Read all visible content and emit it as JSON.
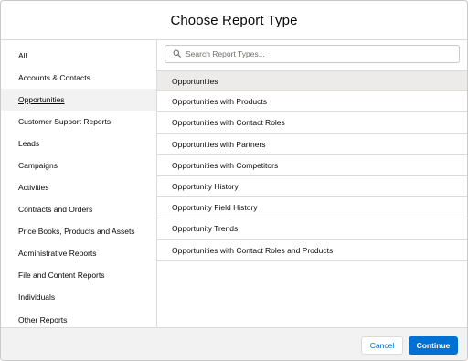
{
  "modal": {
    "title": "Choose Report Type"
  },
  "sidebar": {
    "items": [
      {
        "label": "All"
      },
      {
        "label": "Accounts & Contacts"
      },
      {
        "label": "Opportunities",
        "selected": true
      },
      {
        "label": "Customer Support Reports"
      },
      {
        "label": "Leads"
      },
      {
        "label": "Campaigns"
      },
      {
        "label": "Activities"
      },
      {
        "label": "Contracts and Orders"
      },
      {
        "label": "Price Books, Products and Assets"
      },
      {
        "label": "Administrative Reports"
      },
      {
        "label": "File and Content Reports"
      },
      {
        "label": "Individuals"
      },
      {
        "label": "Other Reports"
      }
    ]
  },
  "search": {
    "placeholder": "Search Report Types...",
    "icon": "search-icon"
  },
  "report_types": [
    {
      "label": "Opportunities",
      "selected": true
    },
    {
      "label": "Opportunities with Products"
    },
    {
      "label": "Opportunities with Contact Roles"
    },
    {
      "label": "Opportunities with Partners"
    },
    {
      "label": "Opportunities with Competitors"
    },
    {
      "label": "Opportunity History"
    },
    {
      "label": "Opportunity Field History"
    },
    {
      "label": "Opportunity Trends"
    },
    {
      "label": "Opportunities with Contact Roles and Products"
    }
  ],
  "footer": {
    "cancel_label": "Cancel",
    "continue_label": "Continue"
  },
  "colors": {
    "brand": "#0070d2",
    "selected_row": "#ecebea",
    "border": "#dddbda"
  }
}
